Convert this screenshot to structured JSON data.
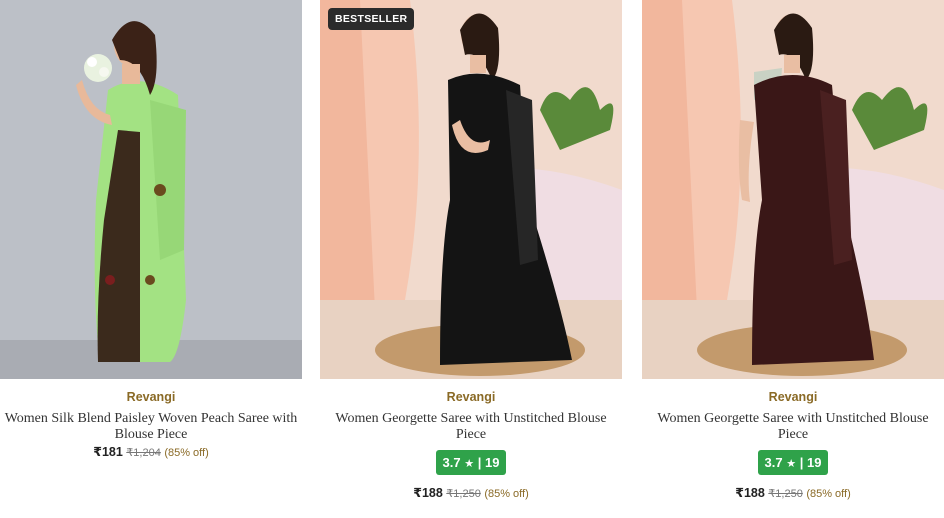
{
  "products": [
    {
      "brand": "Revangi",
      "title": "Women Silk Blend Paisley Woven Peach Saree with Blouse Piece",
      "price": "₹181",
      "mrp": "₹1,204",
      "discount": "(85% off)",
      "saree_color": "#9fe07f",
      "background_color": "#b9bcc3"
    },
    {
      "badge": "BESTSELLER",
      "brand": "Revangi",
      "title": "Women Georgette Saree with Unstitched Blouse Piece",
      "rating": "3.7",
      "rating_count": "19",
      "price": "₹188",
      "mrp": "₹1,250",
      "discount": "(85% off)",
      "saree_color": "#141414",
      "background_color": "#f3d6c9"
    },
    {
      "brand": "Revangi",
      "title": "Women Georgette Saree with Unstitched Blouse Piece",
      "rating": "3.7",
      "rating_count": "19",
      "price": "₹188",
      "mrp": "₹1,250",
      "discount": "(85% off)",
      "saree_color": "#3a1717",
      "background_color": "#f3d6c9"
    }
  ],
  "icons": {
    "rating": "star-icon"
  },
  "colors": {
    "brand_text": "#8a6a26",
    "rating_badge": "#2fa24a"
  }
}
